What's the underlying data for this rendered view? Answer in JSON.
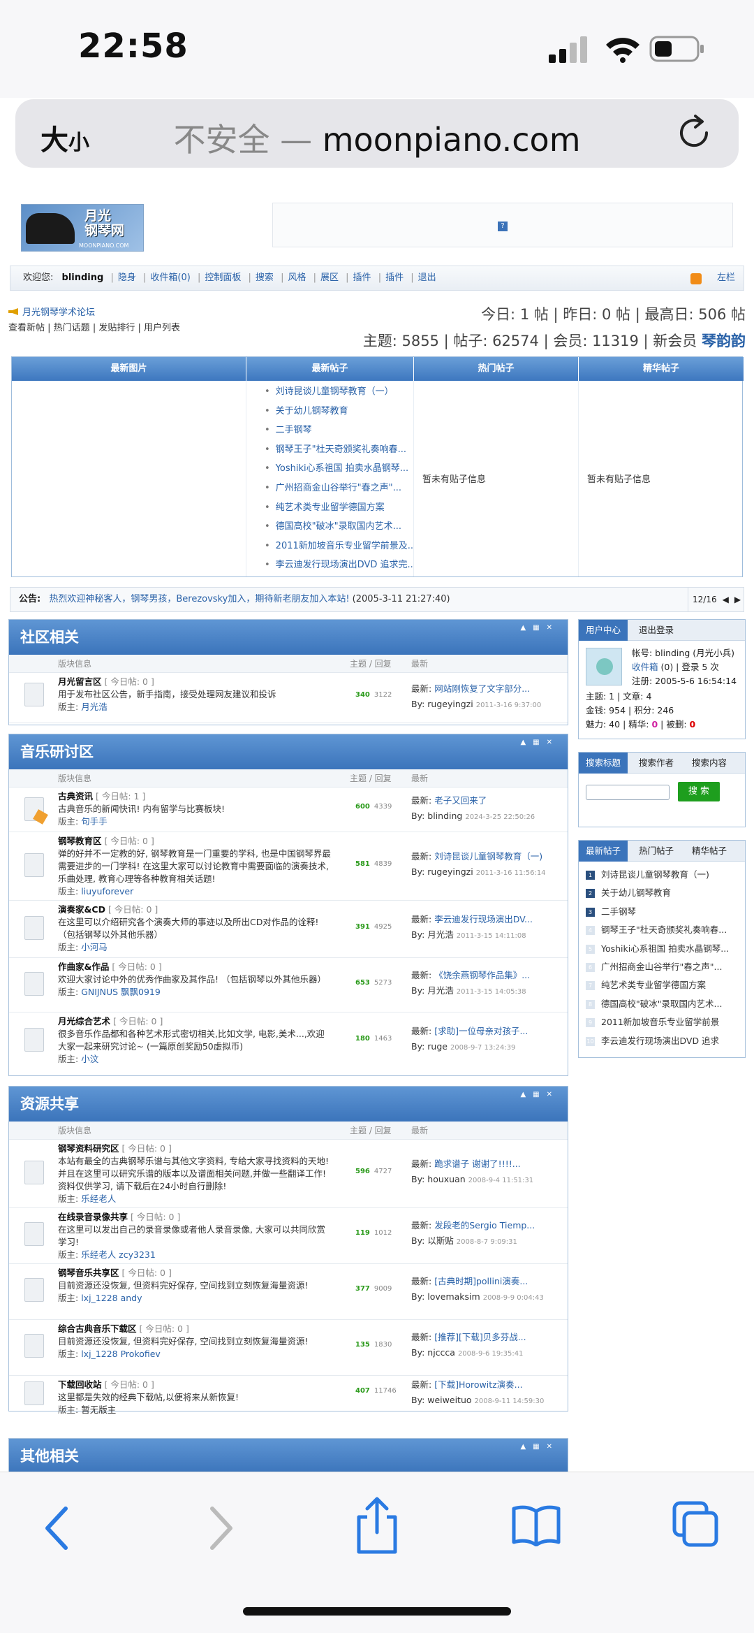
{
  "status": {
    "time": "22:58"
  },
  "browser": {
    "text_size": "大",
    "text_size_small": "小",
    "insecure": "不安全 —",
    "domain": "moonpiano.com"
  },
  "logo": {
    "title_line1": "月光",
    "title_line2": "钢琴网",
    "sub": "MOONPIANO.COM"
  },
  "nav": {
    "welcome": "欢迎您:",
    "user": "blinding",
    "items": [
      "隐身",
      "收件箱(0)",
      "控制面板",
      "搜索",
      "风格",
      "展区",
      "插件",
      "插件",
      "退出"
    ],
    "leftbar": "左栏"
  },
  "forum": {
    "name": "月光钢琴学术论坛",
    "quick": [
      "查看新帖",
      "热门话题",
      "发贴排行",
      "用户列表"
    ]
  },
  "stats": {
    "line1": "今日: 1 帖 | 昨日: 0 帖 | 最高日: 506 帖",
    "line2": "主题: 5855 | 帖子: 62574 | 会员: 11319 | 新会员",
    "newmember": "琴韵韵"
  },
  "grid": {
    "headers": [
      "最新图片",
      "最新帖子",
      "热门帖子",
      "精华帖子"
    ],
    "latest": [
      "刘诗昆谈儿童钢琴教育（一）",
      "关于幼儿钢琴教育",
      "二手钢琴",
      "钢琴王子\"杜天奇颁奖礼奏响春...",
      "Yoshiki心系祖国 拍卖水晶钢琴...",
      "广州招商金山谷举行\"春之声\"...",
      "纯艺术类专业留学德国方案",
      "德国高校\"破冰\"录取国内艺术...",
      "2011新加坡音乐专业留学前景及...",
      "李云迪发行现场演出DVD 追求完..."
    ],
    "hot_none": "暂未有贴子信息",
    "elite_none": "暂未有贴子信息"
  },
  "announce": {
    "label": "公告:",
    "text": "热烈欢迎神秘客人，钢琴男孩，Berezovsky加入，期待新老朋友加入本站!",
    "date": "(2005-3-11 21:27:40)",
    "page": "12/16"
  },
  "colhead": {
    "info": "版块信息",
    "counts": "主题 / 回复",
    "last": "最新"
  },
  "sections": [
    {
      "title": "社区相关",
      "boards": [
        {
          "name": "月光留言区",
          "today": "[ 今日帖: 0 ]",
          "desc": "用于发布社区公告，新手指南，接受处理网友建议和投诉",
          "mod_label": "版主:",
          "mods": "月光浩",
          "topics": "340",
          "replies": "3122",
          "last_label": "最新:",
          "last": "网站刚恢复了文字部分...",
          "by_label": "By:",
          "by": "rugeyingzi",
          "date": "2011-3-16 9:37:00"
        }
      ]
    },
    {
      "title": "音乐研讨区",
      "boards": [
        {
          "name": "古典资讯",
          "today": "[ 今日帖: 1 ]",
          "desc": "古典音乐的新闻快讯! 内有留学与比赛板块!",
          "mod_label": "版主:",
          "mods": "句手手",
          "topics": "600",
          "replies": "4339",
          "last_label": "最新:",
          "last": "老子又回来了",
          "by_label": "By:",
          "by": "blinding",
          "date": "2024-3-25 22:50:26"
        },
        {
          "name": "钢琴教育区",
          "today": "[ 今日帖: 0 ]",
          "desc": "弹的好并不一定教的好, 钢琴教育是一门重要的学科, 也是中国钢琴界最需要进步的一门学科! 在这里大家可以讨论教育中需要面临的演奏技术, 乐曲处理, 教育心理等各种教育相关话题!",
          "mod_label": "版主:",
          "mods": "liuyuforever",
          "topics": "581",
          "replies": "4839",
          "last_label": "最新:",
          "last": "刘诗昆谈儿童钢琴教育（一)",
          "by_label": "By:",
          "by": "rugeyingzi",
          "date": "2011-3-16 11:56:14"
        },
        {
          "name": "演奏家&CD",
          "today": "[ 今日帖: 0 ]",
          "desc": "在这里可以介绍研究各个演奏大师的事迹以及所出CD对作品的诠释! （包括钢琴以外其他乐器）",
          "mod_label": "版主:",
          "mods": "小河马",
          "topics": "391",
          "replies": "4925",
          "last_label": "最新:",
          "last": "李云迪发行现场演出DV...",
          "by_label": "By:",
          "by": "月光浩",
          "date": "2011-3-15 14:11:08"
        },
        {
          "name": "作曲家&作品",
          "today": "[ 今日帖: 0 ]",
          "desc": "欢迎大家讨论中外的优秀作曲家及其作品! （包括钢琴以外其他乐器）",
          "mod_label": "版主:",
          "mods": "GNIJNUS  飘飘0919",
          "topics": "653",
          "replies": "5273",
          "last_label": "最新:",
          "last": "《饶余燕钢琴作品集》...",
          "by_label": "By:",
          "by": "月光浩",
          "date": "2011-3-15 14:05:38"
        },
        {
          "name": "月光综合艺术",
          "today": "[ 今日帖: 0 ]",
          "desc": "很多音乐作品都和各种艺术形式密切相关,比如文学, 电影,美术...,欢迎大家一起来研究讨论~ (一篇原创奖励50虚拟币)",
          "mod_label": "版主:",
          "mods": "小汶",
          "topics": "180",
          "replies": "1463",
          "last_label": "最新:",
          "last": "[求助]一位母亲对孩子...",
          "by_label": "By:",
          "by": "ruge",
          "date": "2008-9-7 13:24:39"
        }
      ]
    },
    {
      "title": "资源共享",
      "boards": [
        {
          "name": "钢琴资料研究区",
          "today": "[ 今日帖: 0 ]",
          "desc": "本站有最全的古典钢琴乐谱与其他文字资料, 专给大家寻找资料的天地! 并且在这里可以研究乐谱的版本以及谱面相关问题,并做一些翻译工作! 资料仅供学习, 请下载后在24小时自行删除!",
          "mod_label": "版主:",
          "mods": "乐经老人",
          "topics": "596",
          "replies": "4727",
          "last_label": "最新:",
          "last": "跪求谱子 谢谢了!!!!...",
          "by_label": "By:",
          "by": "houxuan",
          "date": "2008-9-4 11:51:31"
        },
        {
          "name": "在线录音录像共享",
          "today": "[ 今日帖: 0 ]",
          "desc": "在这里可以发出自己的录音录像或者他人录音录像, 大家可以共同欣赏学习!",
          "mod_label": "版主:",
          "mods": "乐经老人  zcy3231",
          "topics": "119",
          "replies": "1012",
          "last_label": "最新:",
          "last": "发段老的Sergio Tiemp...",
          "by_label": "By:",
          "by": "以斯贴",
          "date": "2008-8-7 9:09:31"
        },
        {
          "name": "钢琴音乐共享区",
          "today": "[ 今日帖: 0 ]",
          "desc": "目前资源还没恢复, 但资料完好保存, 空间找到立刻恢复海量资源!",
          "mod_label": "版主:",
          "mods": "lxj_1228  andy",
          "topics": "377",
          "replies": "9009",
          "last_label": "最新:",
          "last": "[古典时期]pollini演奏...",
          "by_label": "By:",
          "by": "lovemaksim",
          "date": "2008-9-9 0:04:43"
        },
        {
          "name": "综合古典音乐下载区",
          "today": "[ 今日帖: 0 ]",
          "desc": "目前资源还没恢复, 但资料完好保存, 空间找到立刻恢复海量资源!",
          "mod_label": "版主:",
          "mods": "lxj_1228  Prokofiev",
          "topics": "135",
          "replies": "1830",
          "last_label": "最新:",
          "last": "[推荐][下载]贝多芬战...",
          "by_label": "By:",
          "by": "njccca",
          "date": "2008-9-6 19:35:41"
        },
        {
          "name": "下载回收站",
          "today": "[ 今日帖: 0 ]",
          "desc": "这里都是失效的经典下载帖,以便将来从新恢复!",
          "mod_label": "版主:",
          "mods": "暂无版主",
          "topics": "407",
          "replies": "11746",
          "last_label": "最新:",
          "last": "[下载]Horowitz演奏...",
          "by_label": "By:",
          "by": "weiweituo",
          "date": "2008-9-11 14:59:30"
        }
      ]
    },
    {
      "title": "其他相关",
      "boards": []
    }
  ],
  "usercenter": {
    "tabs": [
      "用户中心",
      "退出登录"
    ],
    "account": "帐号: blinding (月光小兵)",
    "inbox": "收件箱",
    "inbox_rest": "(0) | 登录 5 次",
    "reg": "注册: 2005-5-6 16:54:14",
    "line1": "主题: 1 | 文章: 4",
    "line2": "金钱: 954 | 积分: 246",
    "line3_a": "魅力: 40 | 精华:",
    "elite": "0",
    "line3_b": "| 被删:",
    "deleted": "0"
  },
  "search": {
    "tabs": [
      "搜索标题",
      "搜索作者",
      "搜索内容"
    ],
    "button": "搜 索",
    "value": ""
  },
  "newposts": {
    "tabs": [
      "最新帖子",
      "热门帖子",
      "精华帖子"
    ],
    "items": [
      "刘诗昆谈儿童钢琴教育（一)",
      "关于幼儿钢琴教育",
      "二手钢琴",
      "钢琴王子\"杜天奇颁奖礼奏响春...",
      "Yoshiki心系祖国 拍卖水晶钢琴...",
      "广州招商金山谷举行\"春之声\"...",
      "纯艺术类专业留学德国方案",
      "德国高校\"破冰\"录取国内艺术...",
      "2011新加坡音乐专业留学前景",
      "李云迪发行现场演出DVD 追求"
    ],
    "nums": [
      "1",
      "2",
      "3",
      "4",
      "5",
      "6",
      "7",
      "8",
      "9",
      "10"
    ]
  }
}
